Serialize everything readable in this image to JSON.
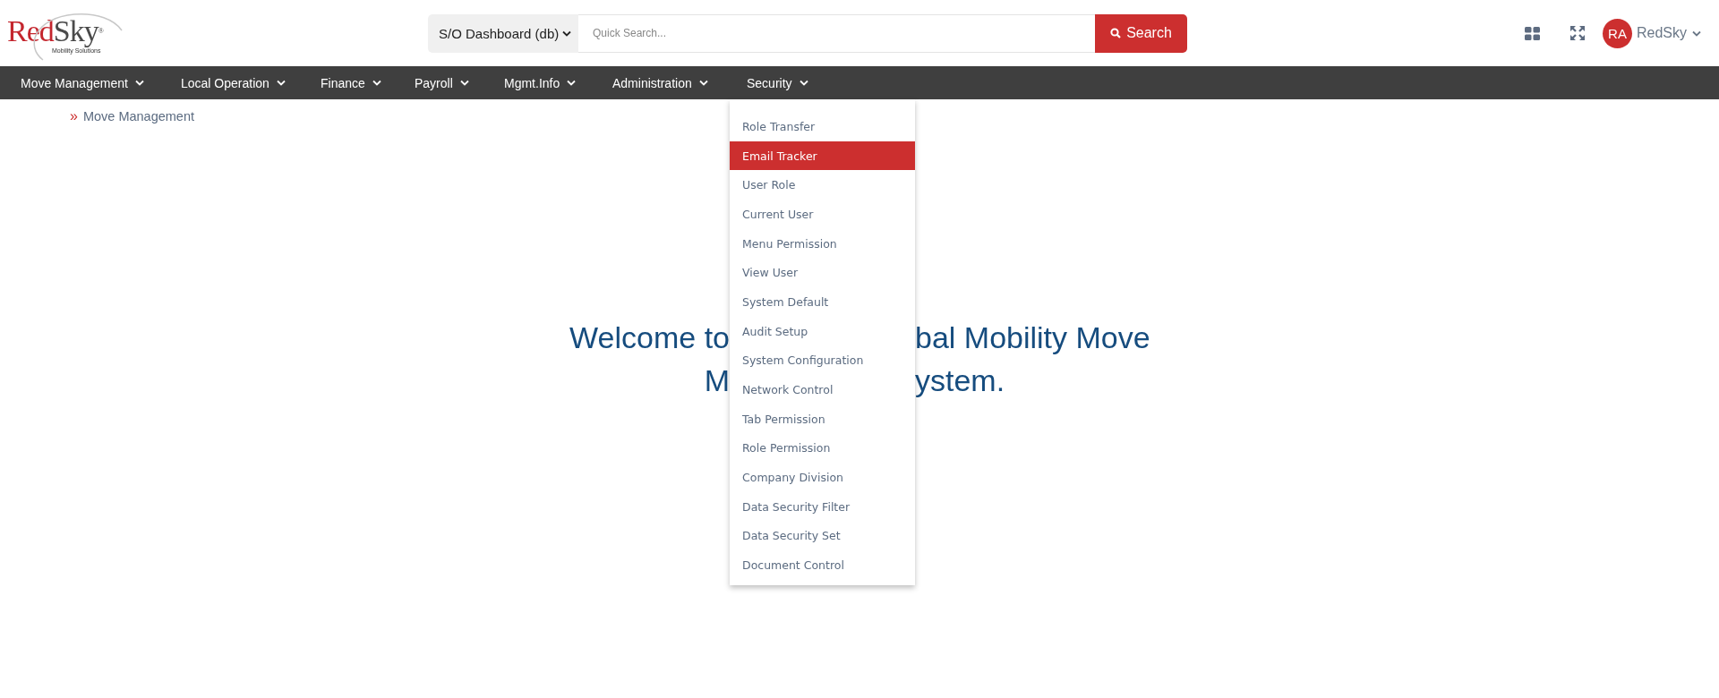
{
  "logo": {
    "brand_first": "Red",
    "brand_second": "Sky",
    "registered": "®",
    "tagline": "Mobility Solutions"
  },
  "search": {
    "dashboard_select": "S/O Dashboard (db)",
    "placeholder": "Quick Search...",
    "button": "Search"
  },
  "user": {
    "initials": "RA",
    "name": "RedSky"
  },
  "nav": [
    {
      "label": "Move Management"
    },
    {
      "label": "Local Operation"
    },
    {
      "label": "Finance"
    },
    {
      "label": "Payroll"
    },
    {
      "label": "Mgmt.Info"
    },
    {
      "label": "Administration"
    },
    {
      "label": "Security",
      "dropdown": [
        {
          "label": "Role Transfer",
          "selected": false
        },
        {
          "label": "Email Tracker",
          "selected": true
        },
        {
          "label": "User Role",
          "selected": false
        },
        {
          "label": "Current User",
          "selected": false
        },
        {
          "label": "Menu Permission",
          "selected": false
        },
        {
          "label": "View User",
          "selected": false
        },
        {
          "label": "System Default",
          "selected": false
        },
        {
          "label": "Audit Setup",
          "selected": false
        },
        {
          "label": "System Configuration",
          "selected": false
        },
        {
          "label": "Network Control",
          "selected": false
        },
        {
          "label": "Tab Permission",
          "selected": false
        },
        {
          "label": "Role Permission",
          "selected": false
        },
        {
          "label": "Company Division",
          "selected": false
        },
        {
          "label": "Data Security Filter",
          "selected": false
        },
        {
          "label": "Data Security Set",
          "selected": false
        },
        {
          "label": "Document Control",
          "selected": false
        }
      ]
    }
  ],
  "breadcrumb": {
    "marker": "»",
    "label": "Move Management"
  },
  "welcome": [
    {
      "left": "Welcome to",
      "right": "bal Mobility Move"
    },
    {
      "left": "M",
      "right": "ystem."
    }
  ]
}
